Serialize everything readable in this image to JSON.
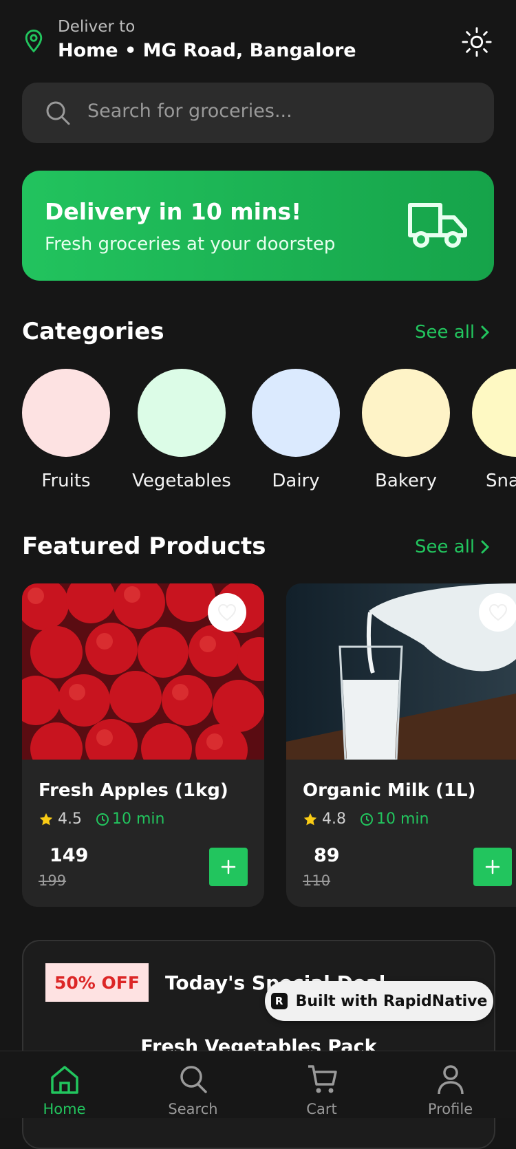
{
  "header": {
    "deliver_label": "Deliver to",
    "address": "Home • MG Road, Bangalore"
  },
  "search": {
    "placeholder": "Search for groceries..."
  },
  "banner": {
    "title": "Delivery in 10 mins!",
    "subtitle": "Fresh groceries at your doorstep"
  },
  "categories": {
    "title": "Categories",
    "see_all": "See all",
    "items": [
      {
        "label": "Fruits",
        "color": "#fde2e2"
      },
      {
        "label": "Vegetables",
        "color": "#dcfce7"
      },
      {
        "label": "Dairy",
        "color": "#dbeafe"
      },
      {
        "label": "Bakery",
        "color": "#fef3c7"
      },
      {
        "label": "Sna",
        "color": "#fef9c3"
      }
    ]
  },
  "featured": {
    "title": "Featured Products",
    "see_all": "See all",
    "products": [
      {
        "name": "Fresh Apples (1kg)",
        "rating": "4.5",
        "time": "10 min",
        "price": "149",
        "old_price": "199"
      },
      {
        "name": "Organic Milk (1L)",
        "rating": "4.8",
        "time": "10 min",
        "price": "89",
        "old_price": "110"
      }
    ]
  },
  "deal": {
    "badge": "50% OFF",
    "title": "Today's Special Deal",
    "product": "Fresh Vegetables Pack"
  },
  "built_with": "Built with RapidNative",
  "tabs": [
    {
      "label": "Home",
      "active": true
    },
    {
      "label": "Search",
      "active": false
    },
    {
      "label": "Cart",
      "active": false
    },
    {
      "label": "Profile",
      "active": false
    }
  ],
  "colors": {
    "accent": "#22c55e",
    "background": "#161616"
  }
}
